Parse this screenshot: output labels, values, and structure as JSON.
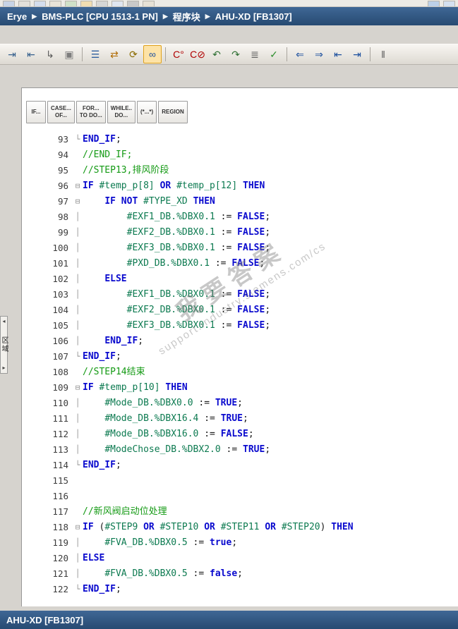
{
  "colors": {
    "titlebar_top": "#3f6795",
    "titlebar_bottom": "#274a72",
    "toolbar_active_bg": "#fde3a7",
    "toolbar_active_border": "#e0a21c"
  },
  "top_strip": {
    "fragments": [
      "#c7d3e6",
      "#e3e0da",
      "#d4dded",
      "#e8e3d8",
      "#cfe0c8",
      "#f0ddb2",
      "#d6d6d6",
      "#e0e6f0",
      "#c9c9c9",
      "#e6e1d6",
      "gap",
      "#bcd0e8",
      "#d4e0f0"
    ]
  },
  "breadcrumb": {
    "separator": "▶",
    "items": [
      "Erye",
      "BMS-PLC [CPU 1513-1 PN]",
      "程序块",
      "AHU-XD [FB1307]"
    ]
  },
  "toolbar": {
    "items": [
      {
        "name": "indent-icon",
        "glyph": "⇥",
        "color": "#37618e"
      },
      {
        "name": "outdent-icon",
        "glyph": "⇤",
        "color": "#37618e"
      },
      {
        "name": "insert-line-icon",
        "glyph": "↳",
        "color": "#5a5a5a"
      },
      {
        "name": "keep-values-icon",
        "glyph": "▣",
        "color": "#7d7d7d"
      },
      {
        "sep": true
      },
      {
        "name": "outline-view-icon",
        "glyph": "☰",
        "color": "#2f5f9e"
      },
      {
        "name": "absolute-symbolic-toggle-icon",
        "glyph": "⇄",
        "color": "#b06a00"
      },
      {
        "name": "update-block-call-icon",
        "glyph": "⟳",
        "color": "#8b6b00"
      },
      {
        "name": "monitoring-glasses-icon",
        "glyph": "∞",
        "color": "#1c4f9e",
        "active": true
      },
      {
        "sep": true
      },
      {
        "name": "call-environment-icon",
        "glyph": "C°",
        "color": "#b00000"
      },
      {
        "name": "clear-call-environment-icon",
        "glyph": "C⊘",
        "color": "#b00000"
      },
      {
        "name": "jump-back-icon",
        "glyph": "↶",
        "color": "#2c6e31"
      },
      {
        "name": "jump-forward-icon",
        "glyph": "↷",
        "color": "#2c6e31"
      },
      {
        "name": "network-list-icon",
        "glyph": "≣",
        "color": "#5a5a5a"
      },
      {
        "name": "syntax-check-icon",
        "glyph": "✓",
        "color": "#2f8f2f"
      },
      {
        "sep": true
      },
      {
        "name": "previous-difference-icon",
        "glyph": "⇐",
        "color": "#1c4f9e"
      },
      {
        "name": "next-difference-icon",
        "glyph": "⇒",
        "color": "#1c4f9e"
      },
      {
        "name": "collapse-calls-icon",
        "glyph": "⇤",
        "color": "#1c4f9e"
      },
      {
        "name": "expand-calls-icon",
        "glyph": "⇥",
        "color": "#1c4f9e"
      },
      {
        "sep": true
      },
      {
        "name": "insert-separator-icon",
        "glyph": "‖",
        "color": "#5a5a5a"
      }
    ]
  },
  "construct_bar": {
    "buttons": [
      {
        "name": "insert-if-button",
        "lines": [
          "IF..."
        ]
      },
      {
        "name": "insert-case-button",
        "lines": [
          "CASE...",
          "OF..."
        ]
      },
      {
        "name": "insert-for-button",
        "lines": [
          "FOR...",
          "TO DO..."
        ]
      },
      {
        "name": "insert-while-button",
        "lines": [
          "WHILE..",
          "DO..."
        ]
      },
      {
        "name": "insert-comment-button",
        "lines": [
          "(*...*)"
        ]
      },
      {
        "name": "insert-region-button",
        "lines": [
          "REGION"
        ]
      }
    ]
  },
  "side_tab": {
    "collapse_icon": "◂",
    "expand_icon": "▸",
    "label": "区域"
  },
  "watermark": {
    "line1": "我要答案",
    "line2": "support.industry.siemens.com/cs"
  },
  "status_bar": {
    "label": "AHU-XD [FB1307]"
  },
  "editor": {
    "colors": {
      "keyword": "#0a0ace",
      "comment": "#149a14",
      "variable": "#0c7a50",
      "plain": "#1a1a1a",
      "line_number": "#3c3c3c",
      "fold": "#909090"
    },
    "lines": [
      {
        "num": 93,
        "fold": "└",
        "indent": 0,
        "segs": [
          [
            "k",
            "END_IF"
          ],
          [
            "p",
            ";"
          ]
        ]
      },
      {
        "num": 94,
        "fold": "",
        "indent": 0,
        "segs": [
          [
            "c",
            "//END_IF;"
          ]
        ]
      },
      {
        "num": 95,
        "fold": "",
        "indent": 0,
        "segs": [
          [
            "c",
            "//STEP13,排风阶段"
          ]
        ]
      },
      {
        "num": 96,
        "fold": "⊟",
        "indent": 0,
        "segs": [
          [
            "k",
            "IF"
          ],
          [
            "p",
            " "
          ],
          [
            "v",
            "#temp_p[8]"
          ],
          [
            "p",
            " "
          ],
          [
            "k",
            "OR"
          ],
          [
            "p",
            " "
          ],
          [
            "v",
            "#temp_p[12]"
          ],
          [
            "p",
            " "
          ],
          [
            "k",
            "THEN"
          ]
        ]
      },
      {
        "num": 97,
        "fold": "⊟",
        "indent": 4,
        "segs": [
          [
            "k",
            "IF"
          ],
          [
            "p",
            " "
          ],
          [
            "k",
            "NOT"
          ],
          [
            "p",
            " "
          ],
          [
            "v",
            "#TYPE_XD"
          ],
          [
            "p",
            " "
          ],
          [
            "k",
            "THEN"
          ]
        ]
      },
      {
        "num": 98,
        "fold": "│",
        "indent": 8,
        "segs": [
          [
            "v",
            "#EXF1_DB.%DBX0.1"
          ],
          [
            "p",
            " := "
          ],
          [
            "k",
            "FALSE"
          ],
          [
            "p",
            ";"
          ]
        ]
      },
      {
        "num": 99,
        "fold": "│",
        "indent": 8,
        "segs": [
          [
            "v",
            "#EXF2_DB.%DBX0.1"
          ],
          [
            "p",
            " := "
          ],
          [
            "k",
            "FALSE"
          ],
          [
            "p",
            ";"
          ]
        ]
      },
      {
        "num": 100,
        "fold": "│",
        "indent": 8,
        "segs": [
          [
            "v",
            "#EXF3_DB.%DBX0.1"
          ],
          [
            "p",
            " := "
          ],
          [
            "k",
            "FALSE"
          ],
          [
            "p",
            ";"
          ]
        ]
      },
      {
        "num": 101,
        "fold": "│",
        "indent": 8,
        "segs": [
          [
            "v",
            "#PXD_DB.%DBX0.1"
          ],
          [
            "p",
            " := "
          ],
          [
            "k",
            "FALSE"
          ],
          [
            "p",
            ";"
          ]
        ]
      },
      {
        "num": 102,
        "fold": "│",
        "indent": 4,
        "segs": [
          [
            "k",
            "ELSE"
          ]
        ]
      },
      {
        "num": 103,
        "fold": "│",
        "indent": 8,
        "segs": [
          [
            "v",
            "#EXF1_DB.%DBX0.1"
          ],
          [
            "p",
            " := "
          ],
          [
            "k",
            "FALSE"
          ],
          [
            "p",
            ";"
          ]
        ]
      },
      {
        "num": 104,
        "fold": "│",
        "indent": 8,
        "segs": [
          [
            "v",
            "#EXF2_DB.%DBX0.1"
          ],
          [
            "p",
            " := "
          ],
          [
            "k",
            "FALSE"
          ],
          [
            "p",
            ";"
          ]
        ]
      },
      {
        "num": 105,
        "fold": "│",
        "indent": 8,
        "segs": [
          [
            "v",
            "#EXF3_DB.%DBX0.1"
          ],
          [
            "p",
            " := "
          ],
          [
            "k",
            "FALSE"
          ],
          [
            "p",
            ";"
          ]
        ]
      },
      {
        "num": 106,
        "fold": "│",
        "indent": 4,
        "segs": [
          [
            "k",
            "END_IF"
          ],
          [
            "p",
            ";"
          ]
        ]
      },
      {
        "num": 107,
        "fold": "└",
        "indent": 0,
        "segs": [
          [
            "k",
            "END_IF"
          ],
          [
            "p",
            ";"
          ]
        ]
      },
      {
        "num": 108,
        "fold": "",
        "indent": 0,
        "segs": [
          [
            "c",
            "//STEP14结束"
          ]
        ]
      },
      {
        "num": 109,
        "fold": "⊟",
        "indent": 0,
        "segs": [
          [
            "k",
            "IF"
          ],
          [
            "p",
            " "
          ],
          [
            "v",
            "#temp_p[10]"
          ],
          [
            "p",
            " "
          ],
          [
            "k",
            "THEN"
          ]
        ]
      },
      {
        "num": 110,
        "fold": "│",
        "indent": 4,
        "segs": [
          [
            "v",
            "#Mode_DB.%DBX0.0"
          ],
          [
            "p",
            " := "
          ],
          [
            "k",
            "TRUE"
          ],
          [
            "p",
            ";"
          ]
        ]
      },
      {
        "num": 111,
        "fold": "│",
        "indent": 4,
        "segs": [
          [
            "v",
            "#Mode_DB.%DBX16.4"
          ],
          [
            "p",
            " := "
          ],
          [
            "k",
            "TRUE"
          ],
          [
            "p",
            ";"
          ]
        ]
      },
      {
        "num": 112,
        "fold": "│",
        "indent": 4,
        "segs": [
          [
            "v",
            "#Mode_DB.%DBX16.0"
          ],
          [
            "p",
            " := "
          ],
          [
            "k",
            "FALSE"
          ],
          [
            "p",
            ";"
          ]
        ]
      },
      {
        "num": 113,
        "fold": "│",
        "indent": 4,
        "segs": [
          [
            "v",
            "#ModeChose_DB.%DBX2.0"
          ],
          [
            "p",
            " := "
          ],
          [
            "k",
            "TRUE"
          ],
          [
            "p",
            ";"
          ]
        ]
      },
      {
        "num": 114,
        "fold": "└",
        "indent": 0,
        "segs": [
          [
            "k",
            "END_IF"
          ],
          [
            "p",
            ";"
          ]
        ]
      },
      {
        "num": 115,
        "fold": "",
        "indent": 0,
        "segs": []
      },
      {
        "num": 116,
        "fold": "",
        "indent": 0,
        "segs": []
      },
      {
        "num": 117,
        "fold": "",
        "indent": 0,
        "segs": [
          [
            "c",
            "//新风阀启动位处理"
          ]
        ]
      },
      {
        "num": 118,
        "fold": "⊟",
        "indent": 0,
        "segs": [
          [
            "k",
            "IF"
          ],
          [
            "p",
            " ("
          ],
          [
            "v",
            "#STEP9"
          ],
          [
            "p",
            " "
          ],
          [
            "k",
            "OR"
          ],
          [
            "p",
            " "
          ],
          [
            "v",
            "#STEP10"
          ],
          [
            "p",
            " "
          ],
          [
            "k",
            "OR"
          ],
          [
            "p",
            " "
          ],
          [
            "v",
            "#STEP11"
          ],
          [
            "p",
            " "
          ],
          [
            "k",
            "OR"
          ],
          [
            "p",
            " "
          ],
          [
            "v",
            "#STEP20"
          ],
          [
            "p",
            ") "
          ],
          [
            "k",
            "THEN"
          ]
        ]
      },
      {
        "num": 119,
        "fold": "│",
        "indent": 4,
        "segs": [
          [
            "v",
            "#FVA_DB.%DBX0.5"
          ],
          [
            "p",
            " := "
          ],
          [
            "k",
            "true"
          ],
          [
            "p",
            ";"
          ]
        ]
      },
      {
        "num": 120,
        "fold": "│",
        "indent": 0,
        "segs": [
          [
            "k",
            "ELSE"
          ]
        ]
      },
      {
        "num": 121,
        "fold": "│",
        "indent": 4,
        "segs": [
          [
            "v",
            "#FVA_DB.%DBX0.5"
          ],
          [
            "p",
            " := "
          ],
          [
            "k",
            "false"
          ],
          [
            "p",
            ";"
          ]
        ]
      },
      {
        "num": 122,
        "fold": "└",
        "indent": 0,
        "segs": [
          [
            "k",
            "END_IF"
          ],
          [
            "p",
            ";"
          ]
        ]
      }
    ]
  }
}
